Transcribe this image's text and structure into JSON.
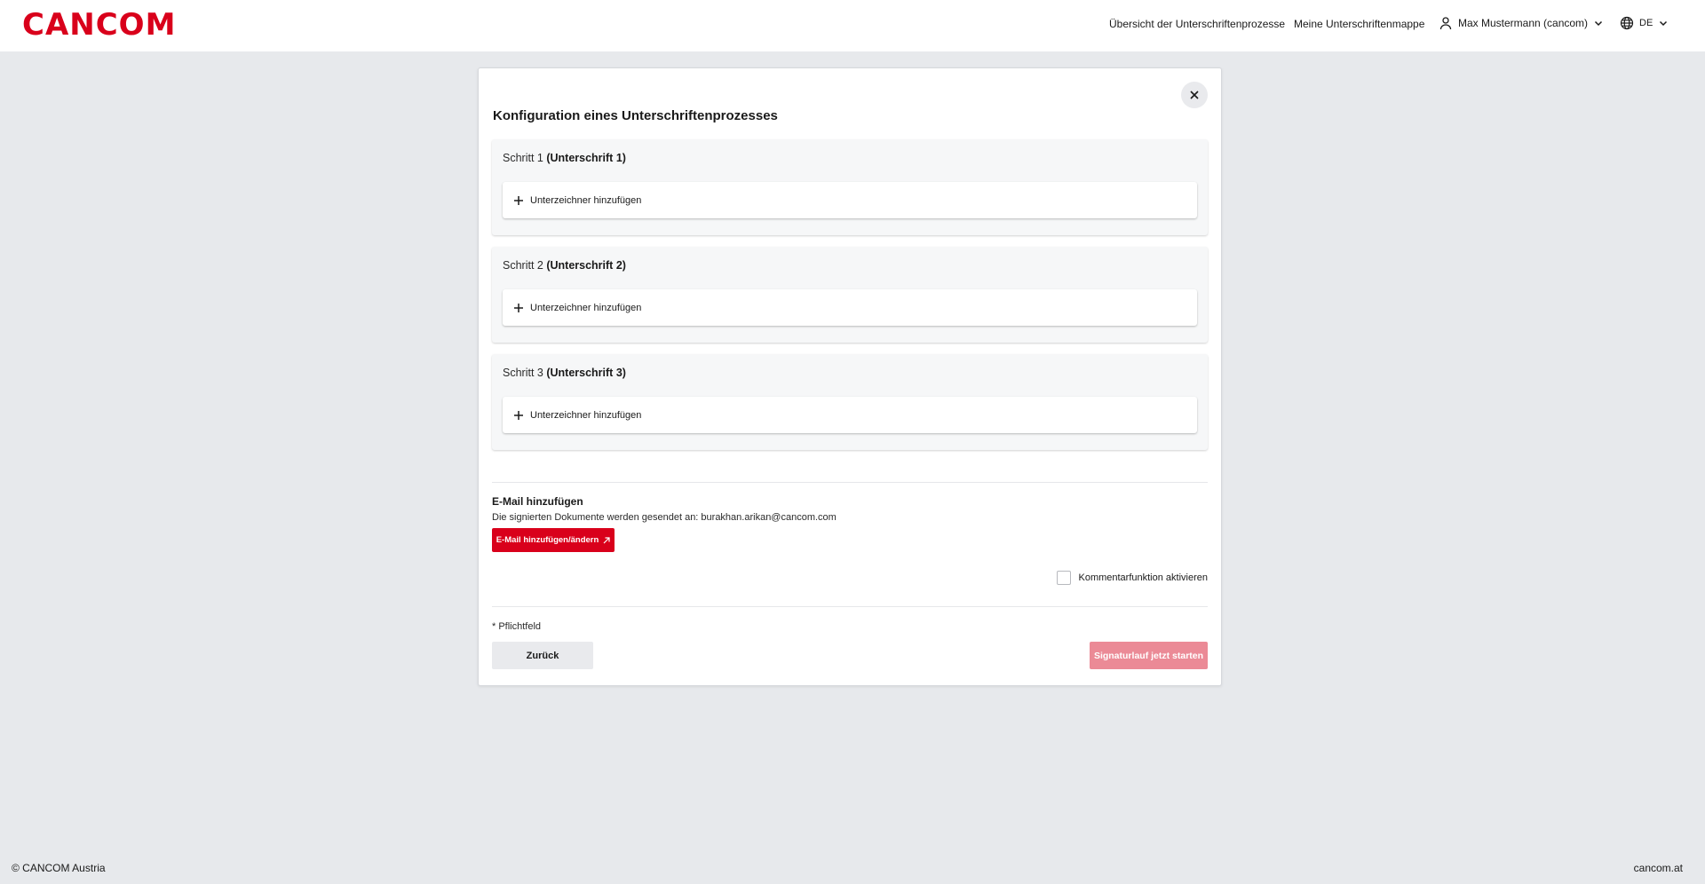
{
  "header": {
    "logo_text": "CANCOM",
    "brand_color": "#d9001b",
    "nav_overview": "Übersicht der Unterschriftenprozesse",
    "nav_folder": "Meine Unterschriftenmappe",
    "user_name": "Max Mustermann (cancom)",
    "language": "DE"
  },
  "dialog": {
    "title": "Konfiguration eines Unterschriftenprozesses",
    "steps": [
      {
        "prefix": "Schritt 1",
        "name": "(Unterschrift 1)",
        "add_label": "Unterzeichner hinzufügen"
      },
      {
        "prefix": "Schritt 2",
        "name": "(Unterschrift 2)",
        "add_label": "Unterzeichner hinzufügen"
      },
      {
        "prefix": "Schritt 3",
        "name": "(Unterschrift 3)",
        "add_label": "Unterzeichner hinzufügen"
      }
    ],
    "email": {
      "title": "E-Mail hinzufügen",
      "text": "Die signierten Dokumente werden gesendet an: burakhan.arikan@cancom.com",
      "button_label": "E-Mail hinzufügen/ändern"
    },
    "comment_label": "Kommentarfunktion aktivieren",
    "comment_checked": false,
    "required_note": "* Pflichtfeld",
    "back_label": "Zurück",
    "start_label": "Signaturlauf jetzt starten"
  },
  "footer": {
    "copyright": "© CANCOM Austria",
    "site": "cancom.at"
  }
}
